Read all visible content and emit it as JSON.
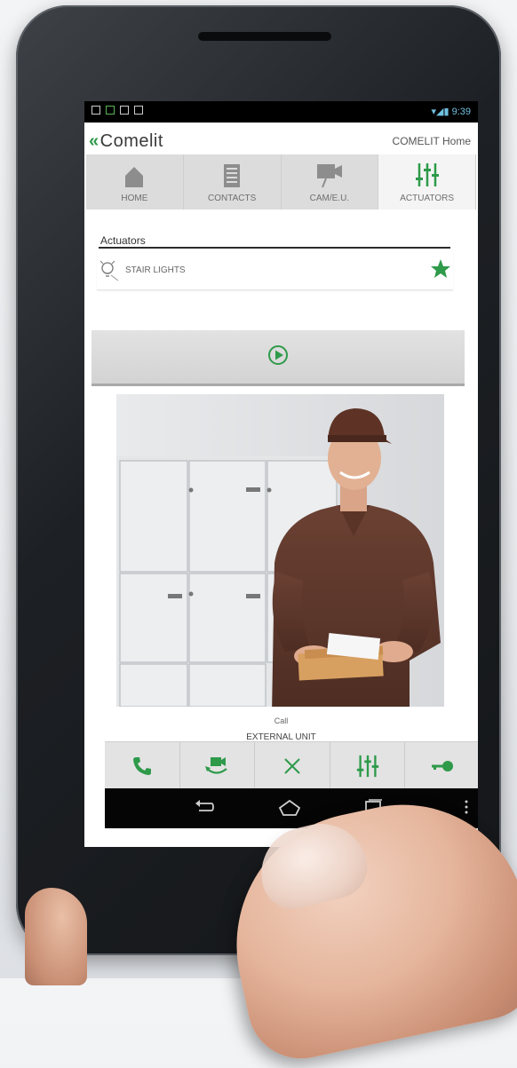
{
  "status_bar": {
    "time": "9:39"
  },
  "header": {
    "brand": "Comelit",
    "location": "COMELIT Home"
  },
  "tabs": [
    {
      "label": "HOME",
      "icon": "home-icon"
    },
    {
      "label": "CONTACTS",
      "icon": "contacts-icon"
    },
    {
      "label": "CAM/E.U.",
      "icon": "camera-icon"
    },
    {
      "label": "ACTUATORS",
      "icon": "sliders-icon",
      "active": true
    }
  ],
  "actuators": {
    "title": "Actuators",
    "items": [
      {
        "label": "STAIR LIGHTS",
        "icon": "lightbulb-icon",
        "favorite": true
      }
    ]
  },
  "call": {
    "label": "Call",
    "unit": "EXTERNAL UNIT"
  },
  "actions": [
    {
      "icon": "phone-icon"
    },
    {
      "icon": "switch-camera-icon"
    },
    {
      "icon": "close-icon"
    },
    {
      "icon": "sliders-icon"
    },
    {
      "icon": "key-icon"
    }
  ],
  "navbar": [
    {
      "icon": "back-icon"
    },
    {
      "icon": "home-icon"
    },
    {
      "icon": "recents-icon"
    },
    {
      "icon": "menu-icon"
    }
  ],
  "colors": {
    "accent": "#2e9a4a",
    "tab_bg": "#dcdcdc",
    "tab_active": "#f4f4f4"
  }
}
